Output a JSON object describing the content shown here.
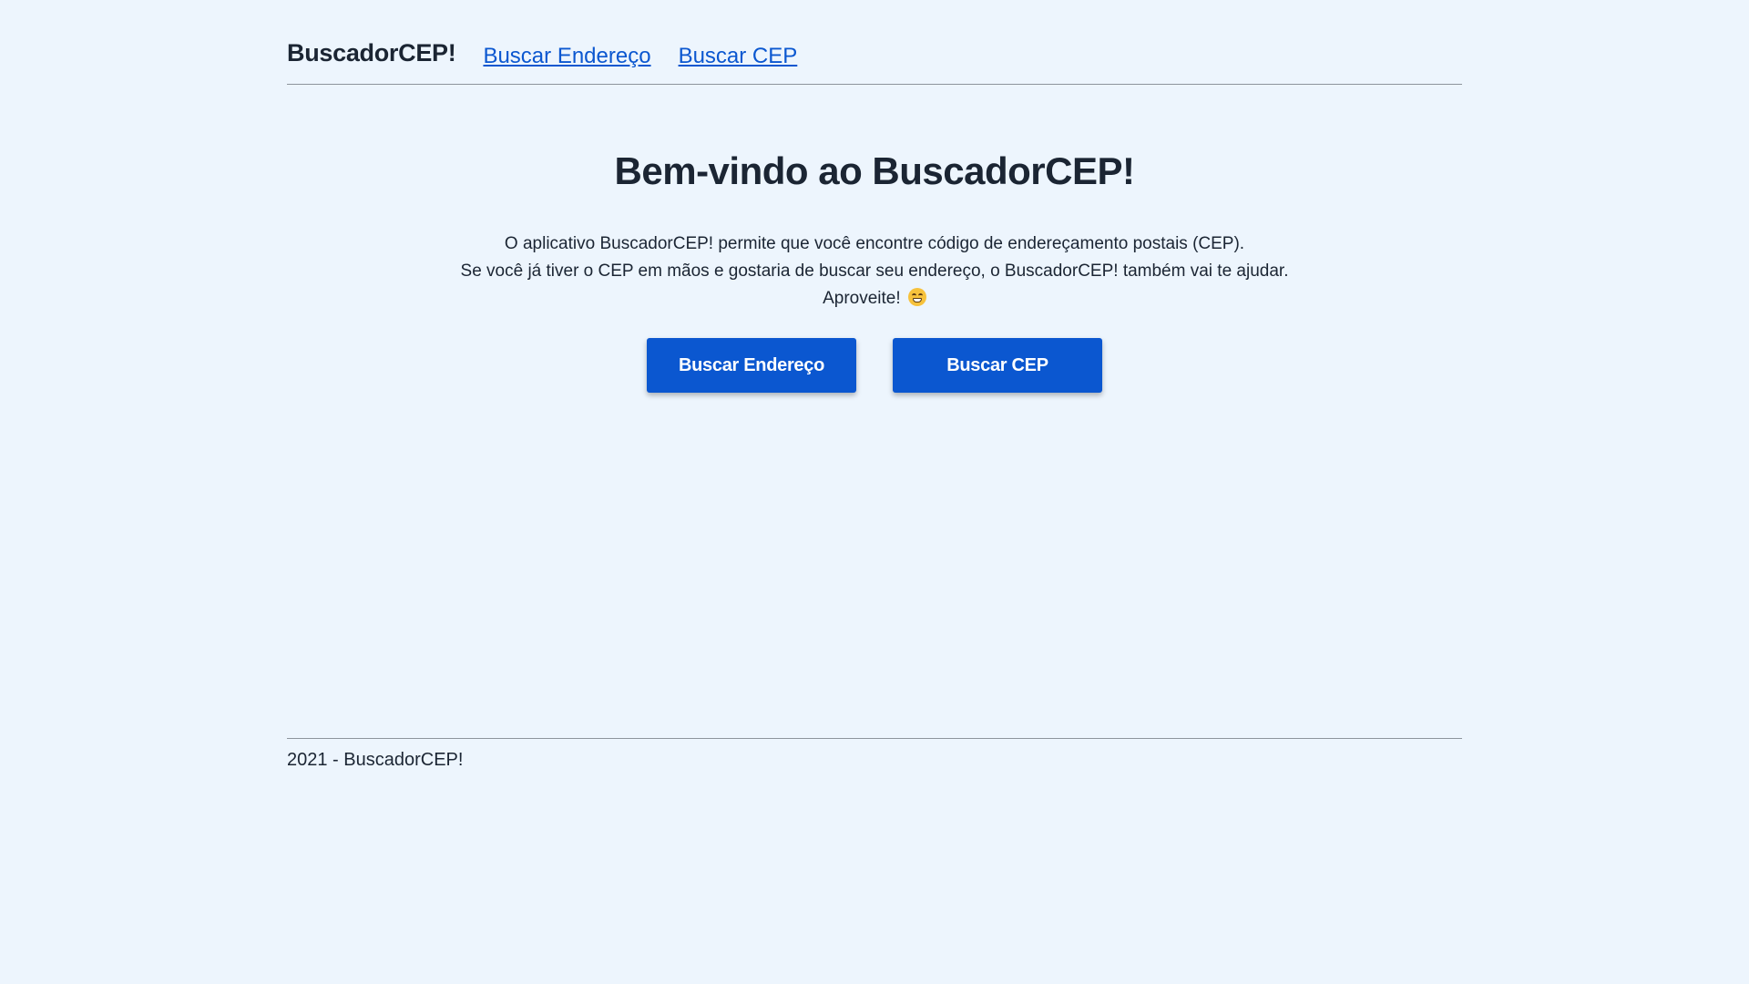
{
  "header": {
    "brand": "BuscadorCEP!",
    "nav": [
      {
        "label": "Buscar Endereço"
      },
      {
        "label": "Buscar CEP"
      }
    ]
  },
  "main": {
    "title": "Bem-vindo ao BuscadorCEP!",
    "description": [
      "O aplicativo BuscadorCEP! permite que você encontre código de endereçamento postais (CEP).",
      "Se você já tiver o CEP em mãos e gostaria de buscar seu endereço, o BuscadorCEP! também vai te ajudar.",
      "Aproveite!"
    ],
    "emoji_icon": "grimacing-face-icon",
    "buttons": [
      {
        "label": "Buscar Endereço"
      },
      {
        "label": "Buscar CEP"
      }
    ]
  },
  "footer": {
    "text": "2021 - BuscadorCEP!"
  },
  "colors": {
    "background": "#edf5fd",
    "accent": "#0b57d0",
    "text": "#1b2533",
    "divider": "#8d949c"
  }
}
